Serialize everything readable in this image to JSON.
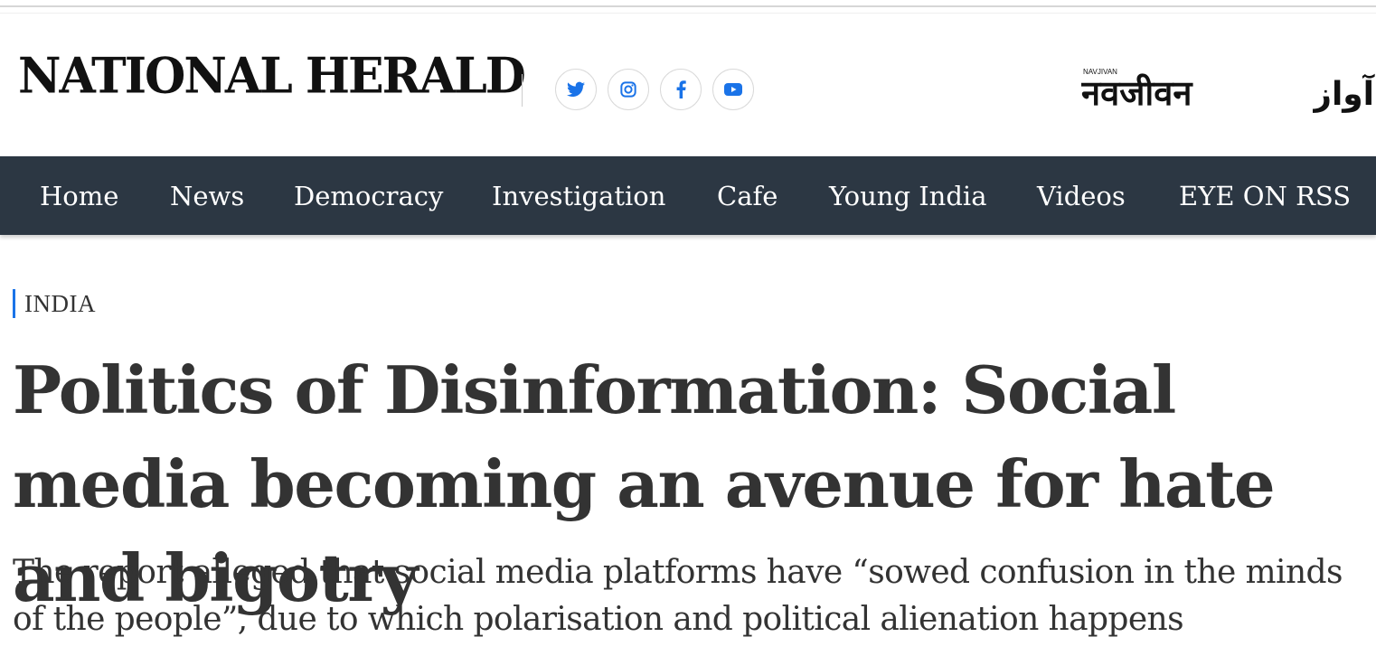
{
  "site": {
    "logo_text": "NATIONAL HERALD",
    "sister_brands": [
      {
        "name": "navjivan",
        "small_label": "NAVJIVAN",
        "text": "नवजीवन"
      },
      {
        "name": "qaumi-awaz",
        "text": "آواز"
      }
    ]
  },
  "social_links": [
    {
      "name": "twitter",
      "icon": "twitter-icon"
    },
    {
      "name": "instagram",
      "icon": "instagram-icon"
    },
    {
      "name": "facebook",
      "icon": "facebook-icon"
    },
    {
      "name": "youtube",
      "icon": "youtube-icon"
    }
  ],
  "nav": {
    "items": [
      {
        "label": "Home"
      },
      {
        "label": "News"
      },
      {
        "label": "Democracy"
      },
      {
        "label": "Investigation"
      },
      {
        "label": "Cafe"
      },
      {
        "label": "Young India"
      },
      {
        "label": "Videos"
      },
      {
        "label": "EYE ON RSS"
      }
    ]
  },
  "article": {
    "section": "INDIA",
    "headline": "Politics of Disinformation: Social media becoming an avenue for hate and bigotry",
    "subheadline": "The report alleged that social media platforms have “sowed confusion in the minds of the people”, due to which polarisation and political alienation happens"
  },
  "colors": {
    "nav_background": "#2c3743",
    "social_icon": "#1a73e8",
    "section_accent": "#1a73e8",
    "text": "#333333"
  }
}
